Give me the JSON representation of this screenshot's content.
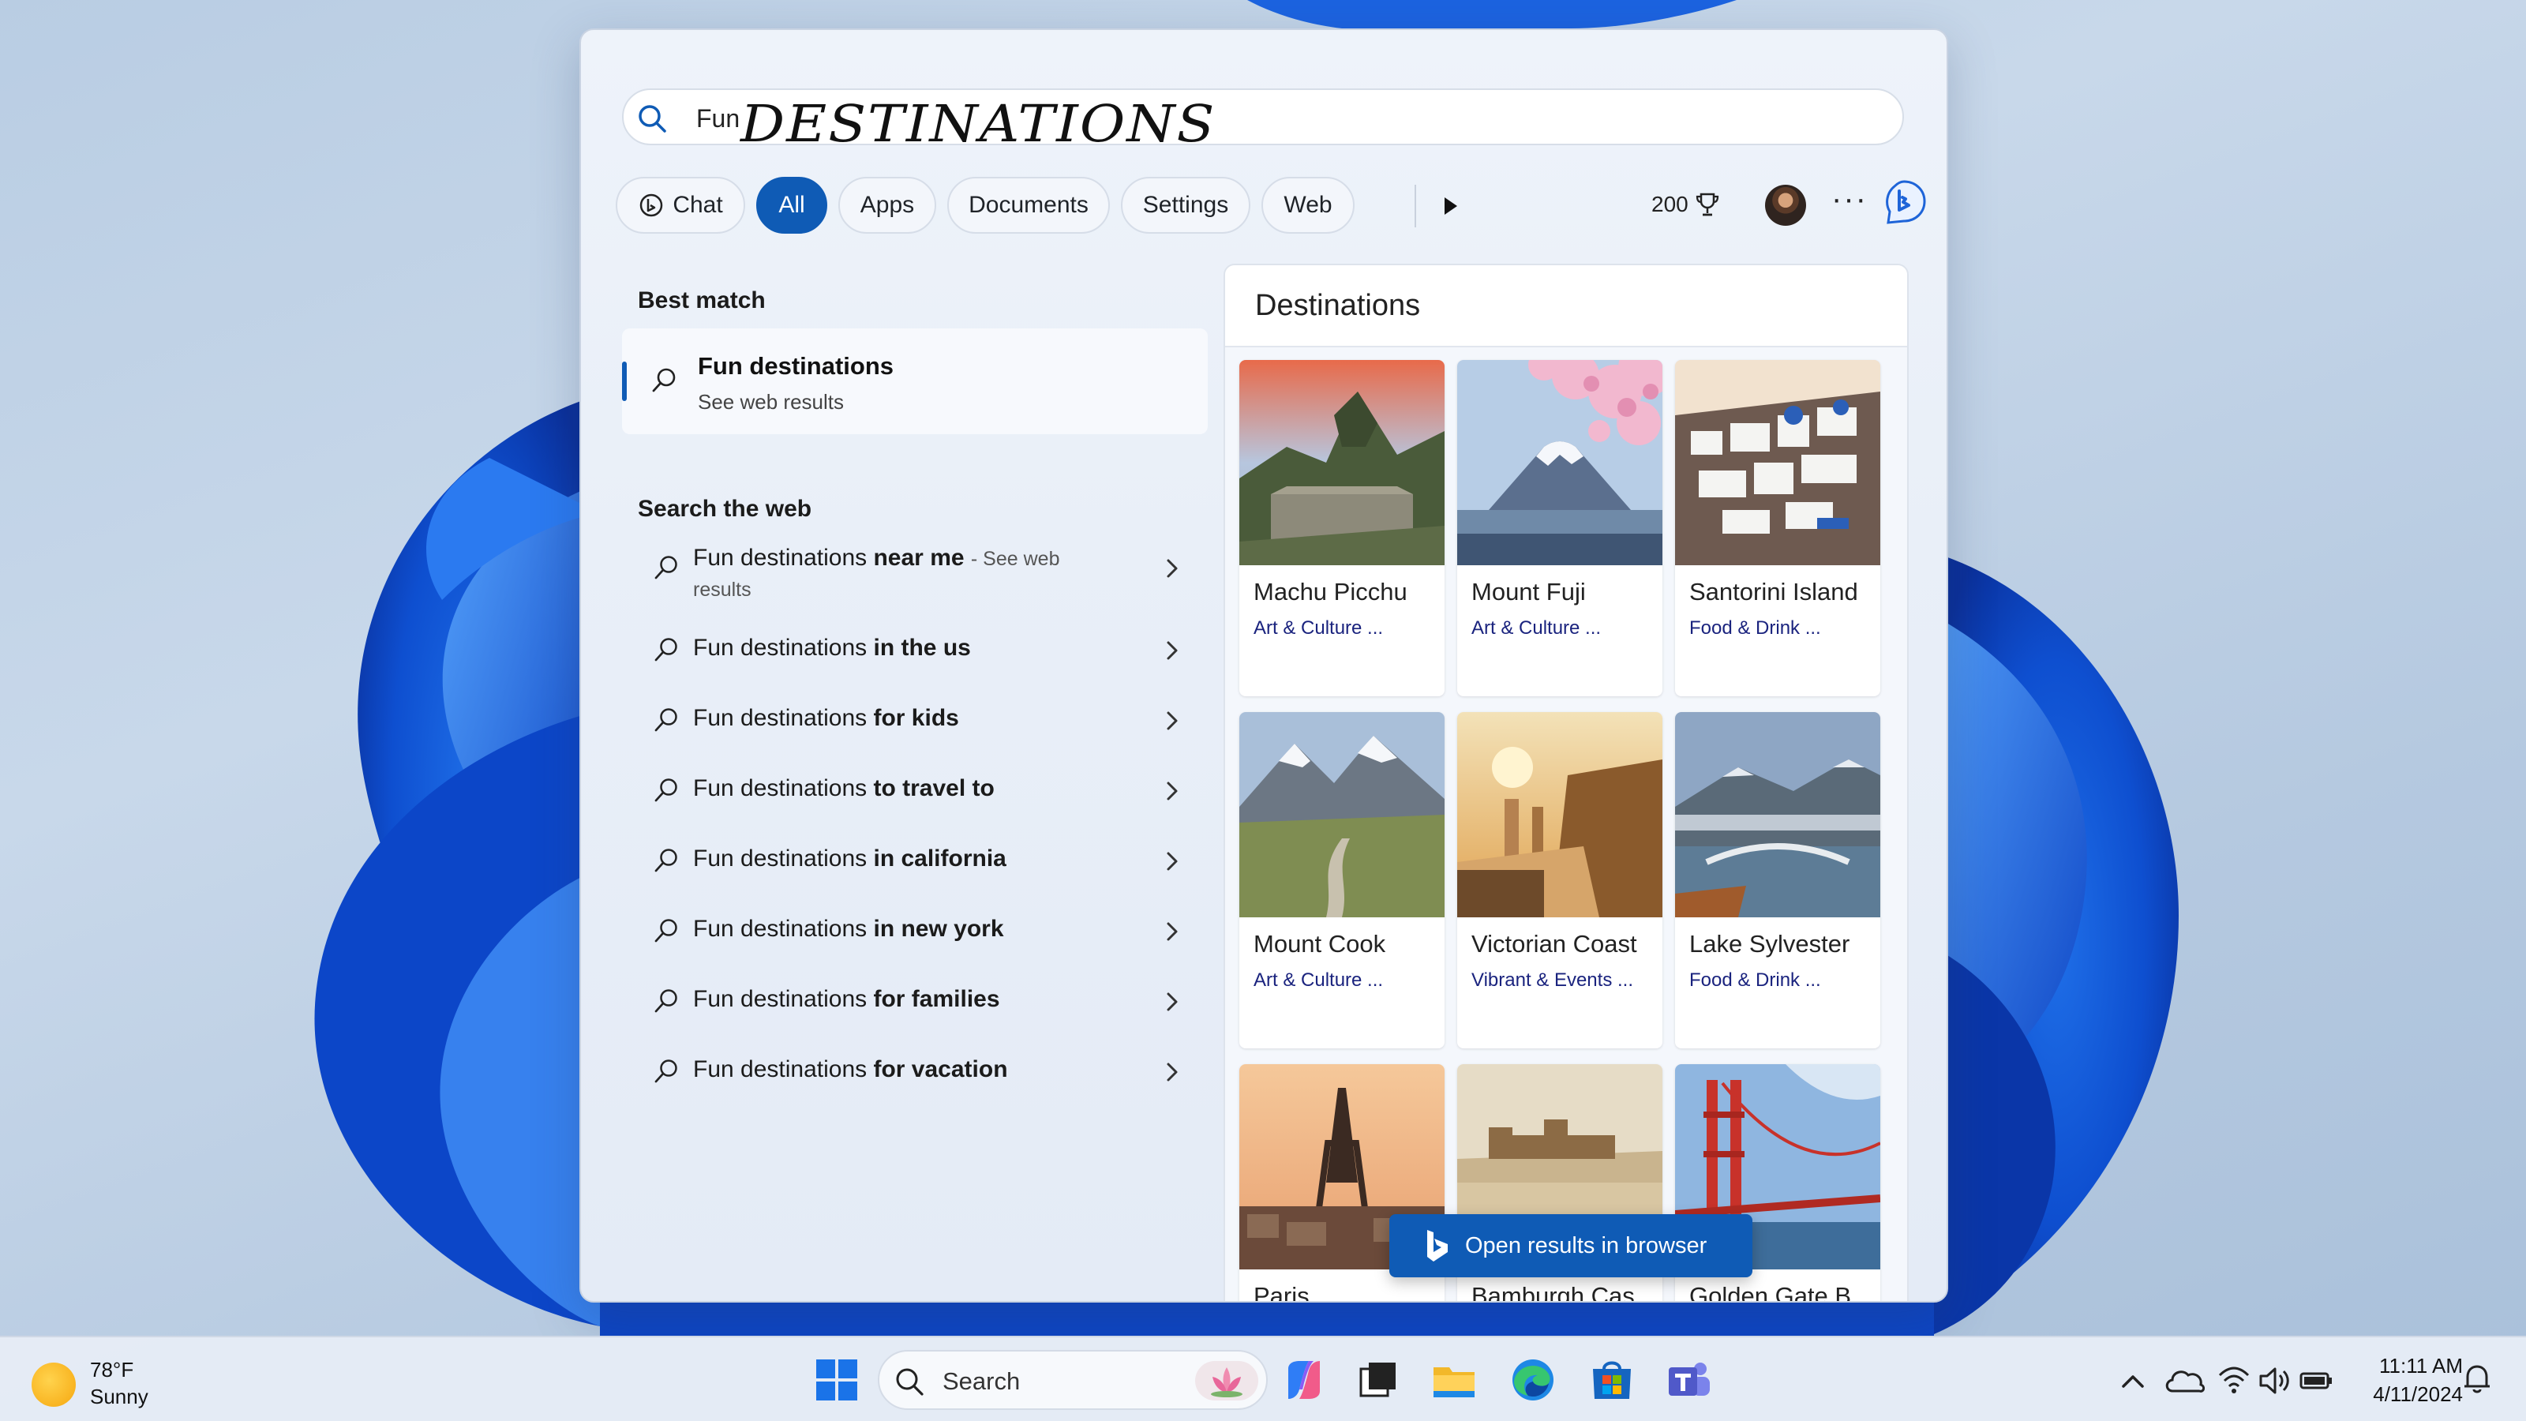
{
  "search": {
    "query_typed": "Fun",
    "query_ink": "DESTINATIONS"
  },
  "filters": {
    "items": [
      "Chat",
      "All",
      "Apps",
      "Documents",
      "Settings",
      "Web"
    ],
    "active": "All",
    "points": "200"
  },
  "left": {
    "best_match_title": "Best match",
    "best_match": {
      "title": "Fun destinations",
      "subtitle": "See web results"
    },
    "search_web_title": "Search the web",
    "web_results": [
      {
        "prefix": "Fun destinations",
        "bold": "near me",
        "hint": "- See web",
        "hint2": "results"
      },
      {
        "prefix": "Fun destinations",
        "bold": "in the us"
      },
      {
        "prefix": "Fun destinations",
        "bold": "for kids"
      },
      {
        "prefix": "Fun destinations",
        "bold": "to travel to"
      },
      {
        "prefix": "Fun destinations",
        "bold": "in california"
      },
      {
        "prefix": "Fun destinations",
        "bold": "in new york"
      },
      {
        "prefix": "Fun destinations",
        "bold": "for families"
      },
      {
        "prefix": "Fun destinations",
        "bold": "for vacation"
      }
    ]
  },
  "right": {
    "title": "Destinations",
    "cards": [
      {
        "name": "Machu Picchu",
        "category": "Art & Culture ...",
        "scene": "mountain-ruins"
      },
      {
        "name": "Mount Fuji",
        "category": "Art & Culture ...",
        "scene": "fuji-blossom"
      },
      {
        "name": "Santorini Island",
        "category": "Food & Drink ...",
        "scene": "white-village"
      },
      {
        "name": "Mount Cook",
        "category": "Art & Culture ...",
        "scene": "snow-peak"
      },
      {
        "name": "Victorian Coast",
        "category": "Vibrant & Events ...",
        "scene": "sunset-coast"
      },
      {
        "name": "Lake Sylvester",
        "category": "Food & Drink ...",
        "scene": "lake-bridge"
      },
      {
        "name": "Paris",
        "category": "",
        "scene": "eiffel"
      },
      {
        "name": "Bamburgh Cas...",
        "category": "",
        "scene": "castle"
      },
      {
        "name": "Golden Gate B...",
        "category": "",
        "scene": "red-bridge"
      }
    ],
    "open_browser": "Open results in browser"
  },
  "taskbar": {
    "weather_temp": "78°F",
    "weather_cond": "Sunny",
    "search_label": "Search",
    "time": "11:11 AM",
    "date": "4/11/2024"
  },
  "colors": {
    "accent": "#0f5bb5",
    "category_text": "#1a237e"
  }
}
